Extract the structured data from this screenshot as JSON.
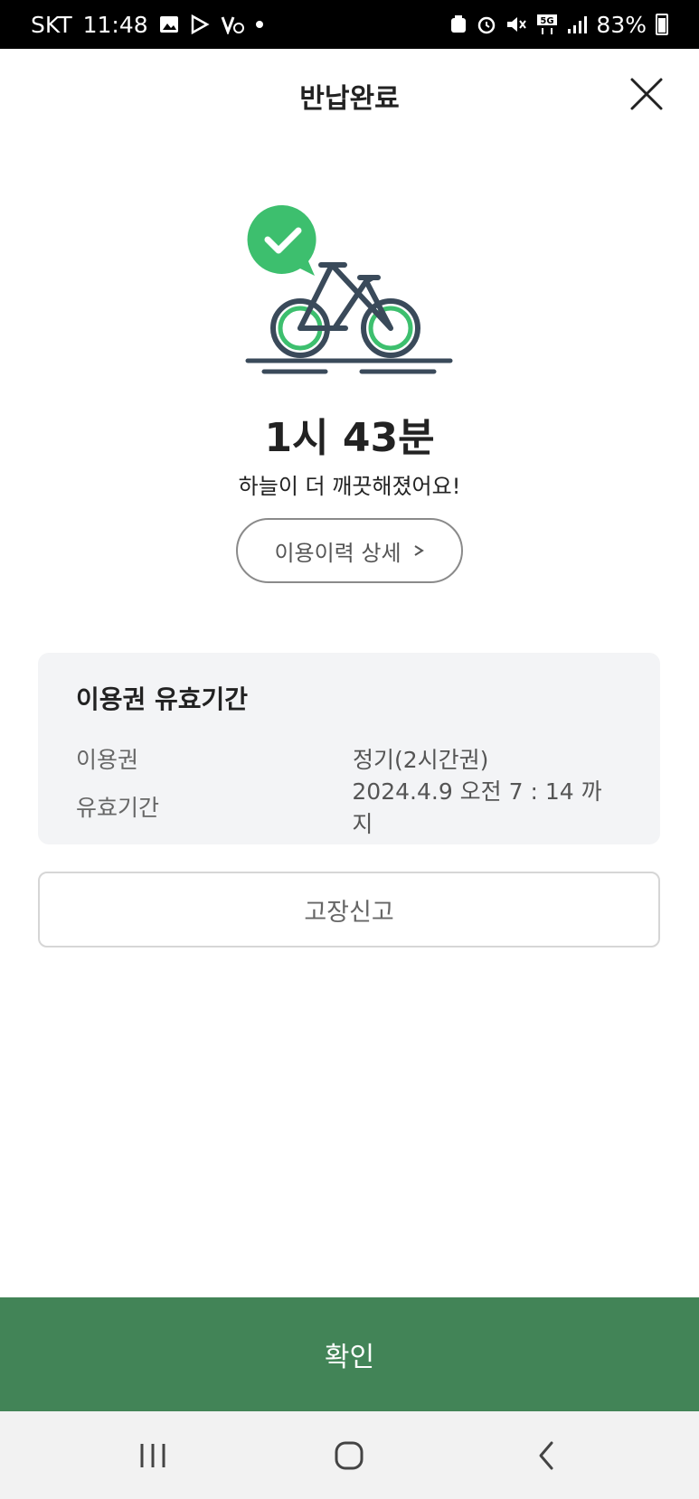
{
  "status_bar": {
    "carrier": "SKT",
    "time": "11:48",
    "battery": "83%"
  },
  "header": {
    "title": "반납완료"
  },
  "result": {
    "duration": "1시 43분",
    "message": "하늘이 더 깨끗해졌어요!",
    "history_button_label": "이용이력 상세"
  },
  "pass_info": {
    "title": "이용권 유효기간",
    "rows": [
      {
        "label": "이용권",
        "value": "정기(2시간권)"
      },
      {
        "label": "유효기간",
        "value": "2024.4.9 오전 7 : 14 까지"
      }
    ]
  },
  "report_button_label": "고장신고",
  "confirm_button_label": "확인",
  "colors": {
    "accent_green": "#428457",
    "check_green": "#3dbf6e",
    "card_bg": "#f3f4f6"
  }
}
